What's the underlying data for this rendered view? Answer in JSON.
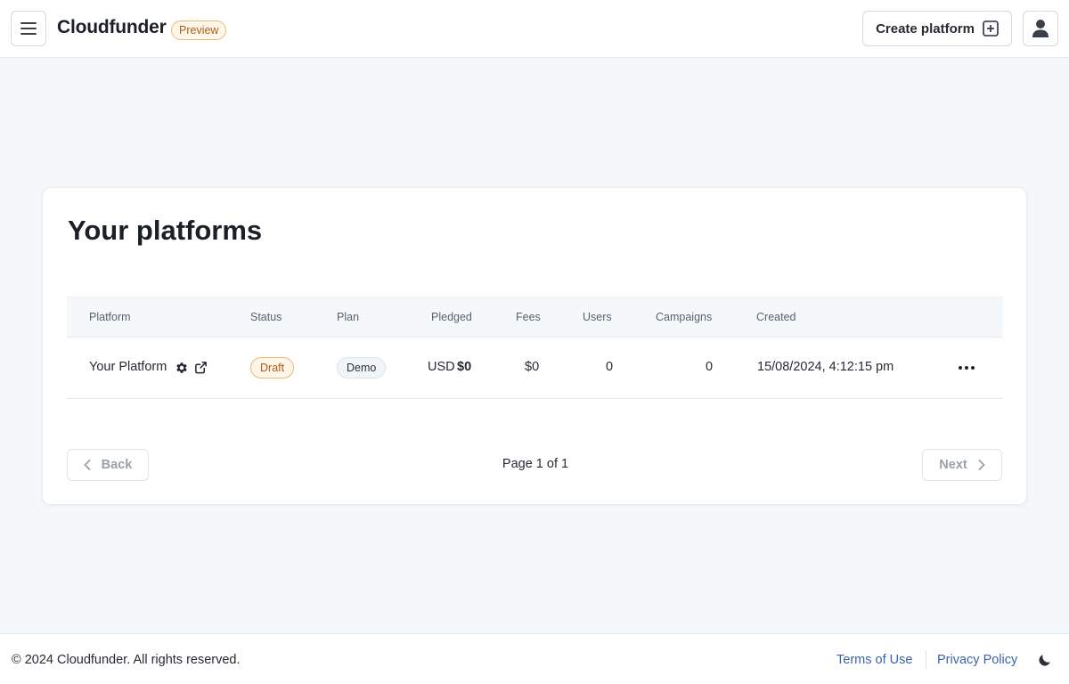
{
  "app": {
    "brand": "Cloudfunder",
    "badge": "Preview"
  },
  "header": {
    "create_label": "Create platform"
  },
  "main": {
    "title": "Your platforms",
    "columns": [
      "Platform",
      "Status",
      "Plan",
      "Pledged",
      "Fees",
      "Users",
      "Campaigns",
      "Created"
    ],
    "rows": [
      {
        "platform": "Your Platform",
        "status": "Draft",
        "plan": "Demo",
        "pledged_currency": "USD",
        "pledged_amount": "$0",
        "fees": "$0",
        "users": "0",
        "campaigns": "0",
        "created": "15/08/2024, 4:12:15 pm"
      }
    ],
    "pagination": {
      "back_label": "Back",
      "page_info": "Page 1 of 1",
      "next_label": "Next"
    }
  },
  "footer": {
    "copyright": "© 2024 Cloudfunder. All rights reserved.",
    "terms_label": "Terms of Use",
    "privacy_label": "Privacy Policy"
  },
  "icons": {
    "menu": "hamburger-menu-icon",
    "create": "plus-square-icon",
    "user": "user-icon",
    "settings": "gear-icon",
    "external": "external-link-icon",
    "more": "more-horizontal-icon",
    "back": "chevron-left-icon",
    "next": "chevron-right-icon",
    "theme": "moon-icon"
  },
  "colors": {
    "badge_warning_text": "#b45a14",
    "badge_warning_border": "#eab974",
    "link": "#3a64a8",
    "background": "#f5f8fb"
  }
}
